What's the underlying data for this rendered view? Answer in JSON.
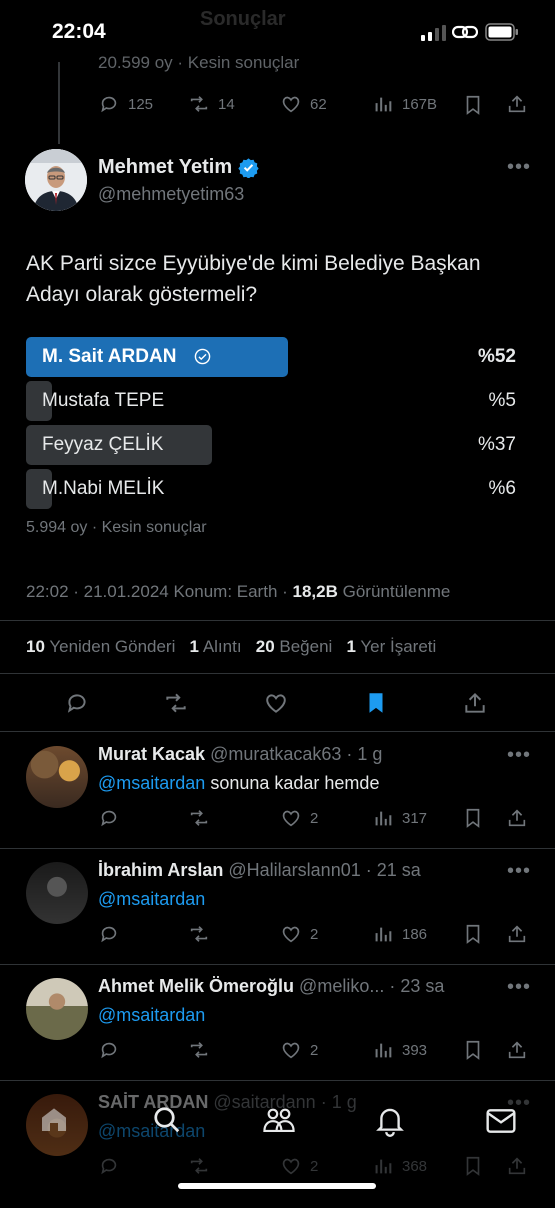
{
  "status_bar": {
    "time": "22:04"
  },
  "prev_tweet": {
    "ghost_text": "Sonuçlar",
    "meta": "20.599 oy · Kesin sonuçlar",
    "replies": "125",
    "reposts": "14",
    "likes": "62",
    "views": "167B"
  },
  "tweet": {
    "author_name": "Mehmet Yetim",
    "author_handle": "@mehmetyetim63",
    "text": "AK Parti sizce Eyyübiye'de kimi Belediye Başkan Adayı olarak göstermeli?",
    "poll": {
      "options": [
        {
          "label": "M. Sait ARDAN",
          "percent": "%52",
          "share": 0.52,
          "winner": true
        },
        {
          "label": "Mustafa TEPE",
          "percent": "%5",
          "share": 0.05,
          "winner": false
        },
        {
          "label": "Feyyaz ÇELİK",
          "percent": "%37",
          "share": 0.37,
          "winner": false
        },
        {
          "label": "M.Nabi MELİK",
          "percent": "%6",
          "share": 0.06,
          "winner": false
        }
      ],
      "meta": "5.994 oy · Kesin sonuçlar"
    },
    "timestamp": "22:02 · 21.01.2024 Konum: Earth · ",
    "views_count": "18,2B",
    "views_label": "Görüntülenme",
    "stats": {
      "reposts_count": "10",
      "reposts_label": "Yeniden Gönderi",
      "quotes_count": "1",
      "quotes_label": "Alıntı",
      "likes_count": "20",
      "likes_label": "Beğeni",
      "bookmarks_count": "1",
      "bookmarks_label": "Yer İşareti"
    },
    "accent_color": "#1d9bf0"
  },
  "replies": [
    {
      "name": "Murat Kacak",
      "handle": "@muratkacak63",
      "time": "· 1 g",
      "mention": "@msaitardan",
      "text": " sonuna kadar hemde",
      "replies": "",
      "reposts": "",
      "likes": "2",
      "views": "317"
    },
    {
      "name": "İbrahim Arslan",
      "handle": "@Halilarslann01",
      "time": "· 21 sa",
      "mention": "@msaitardan",
      "text": "",
      "replies": "",
      "reposts": "",
      "likes": "2",
      "views": "186"
    },
    {
      "name": "Ahmet Melik Ömeroğlu",
      "handle": "@meliko...",
      "time": "· 23 sa",
      "mention": "@msaitardan",
      "text": "",
      "replies": "",
      "reposts": "",
      "likes": "2",
      "views": "393"
    },
    {
      "name": "SAİT ARDAN",
      "handle": "@saitardann",
      "time": "· 1 g",
      "mention": "@msaitardan",
      "text": "",
      "replies": "",
      "reposts": "",
      "likes": "2",
      "views": "368"
    }
  ],
  "tab_bar": {
    "items": [
      "home-icon",
      "search-icon",
      "communities-icon",
      "notifications-icon",
      "messages-icon"
    ]
  }
}
